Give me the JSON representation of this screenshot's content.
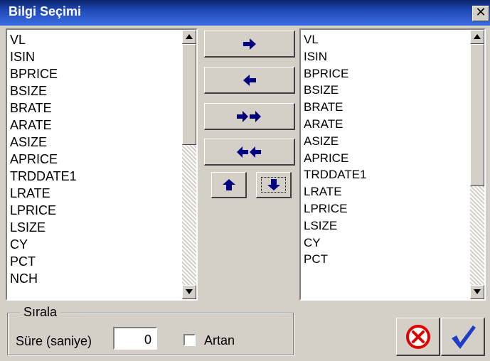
{
  "window": {
    "title": "Bilgi Seçimi",
    "close_glyph": "✕"
  },
  "left_list": {
    "items": [
      "VL",
      "ISIN",
      "BPRICE",
      "BSIZE",
      "BRATE",
      "ARATE",
      "ASIZE",
      "APRICE",
      "TRDDATE1",
      "LRATE",
      "LPRICE",
      "LSIZE",
      "CY",
      "PCT",
      "NCH"
    ]
  },
  "right_list": {
    "items": [
      "VL",
      "ISIN",
      "BPRICE",
      "BSIZE",
      "BRATE",
      "ARATE",
      "ASIZE",
      "APRICE",
      "TRDDATE1",
      "LRATE",
      "LPRICE",
      "LSIZE",
      "CY",
      "PCT"
    ]
  },
  "move_buttons": {
    "add_one": "arrow-right-icon",
    "remove_one": "arrow-left-icon",
    "add_all": "double-arrow-right-icon",
    "remove_all": "double-arrow-left-icon",
    "move_up": "arrow-up-icon",
    "move_down": "arrow-down-icon"
  },
  "sort_group": {
    "label": "Sırala",
    "duration_label": "Süre (saniye)",
    "duration_value": "0",
    "ascending_label": "Artan",
    "ascending_checked": false
  },
  "actions": {
    "cancel": "cancel-icon",
    "ok": "checkmark-icon"
  },
  "colors": {
    "title_bar": "#0a246a",
    "arrow": "#000080",
    "cancel": "#e00000",
    "ok": "#1e3cc8",
    "face": "#d4d0c8"
  }
}
